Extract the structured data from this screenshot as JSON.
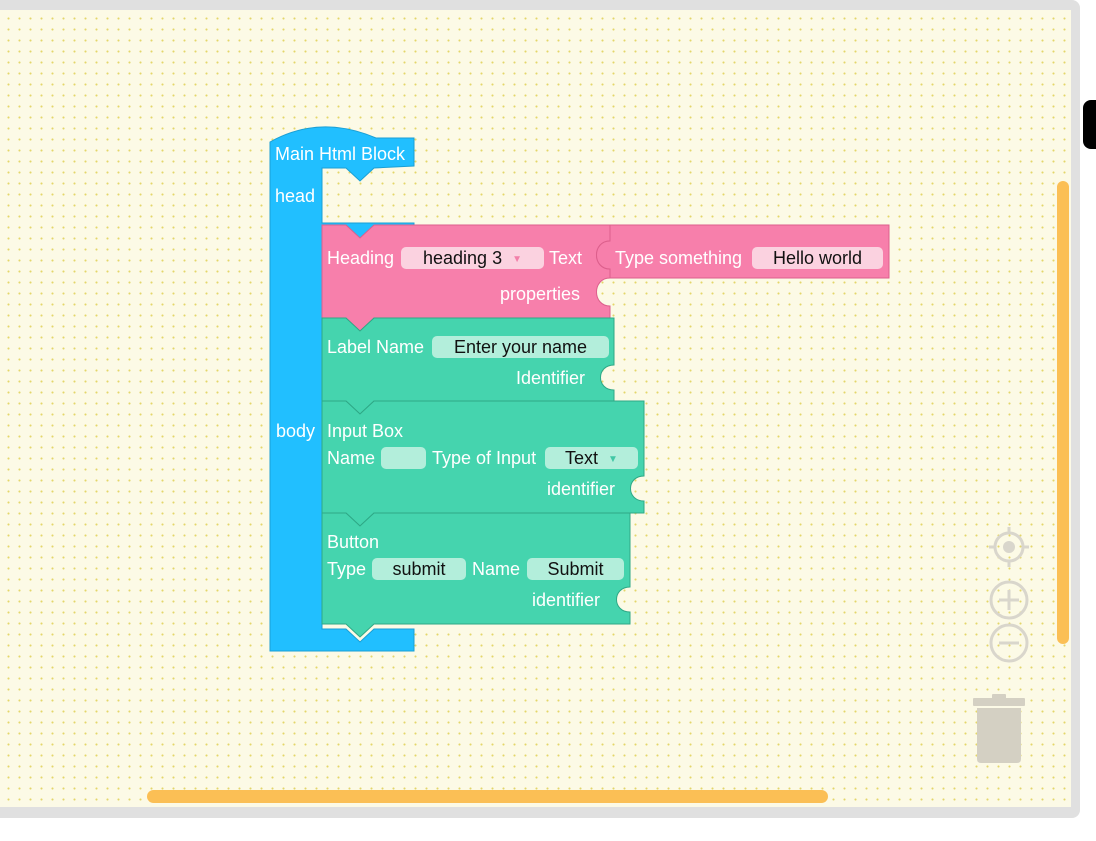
{
  "main_block": {
    "title": "Main Html Block",
    "head_label": "head",
    "body_label": "body"
  },
  "heading_block": {
    "label": "Heading",
    "level_value": "heading 3",
    "text_label": "Text",
    "properties_label": "properties"
  },
  "text_block": {
    "label": "Type something",
    "value": "Hello world"
  },
  "label_block": {
    "label": "Label Name",
    "value": "Enter your name",
    "identifier_label": "Identifier"
  },
  "input_block": {
    "title": "Input Box",
    "name_label": "Name",
    "name_value": "",
    "type_label": "Type of Input",
    "type_value": "Text",
    "identifier_label": "identifier"
  },
  "button_block": {
    "title": "Button",
    "type_label": "Type",
    "type_value": "submit",
    "name_label": "Name",
    "name_value": "Submit",
    "identifier_label": "identifier"
  },
  "colors": {
    "workspace": "#fcfae6",
    "main_block": "#21bfff",
    "heading_block": "#f77fab",
    "form_blocks": "#45d4ae",
    "scrollbar": "#fbbf55",
    "controls": "#d9d6cc"
  },
  "controls": [
    "recenter-icon",
    "zoom-in-icon",
    "zoom-out-icon",
    "trash-icon"
  ]
}
